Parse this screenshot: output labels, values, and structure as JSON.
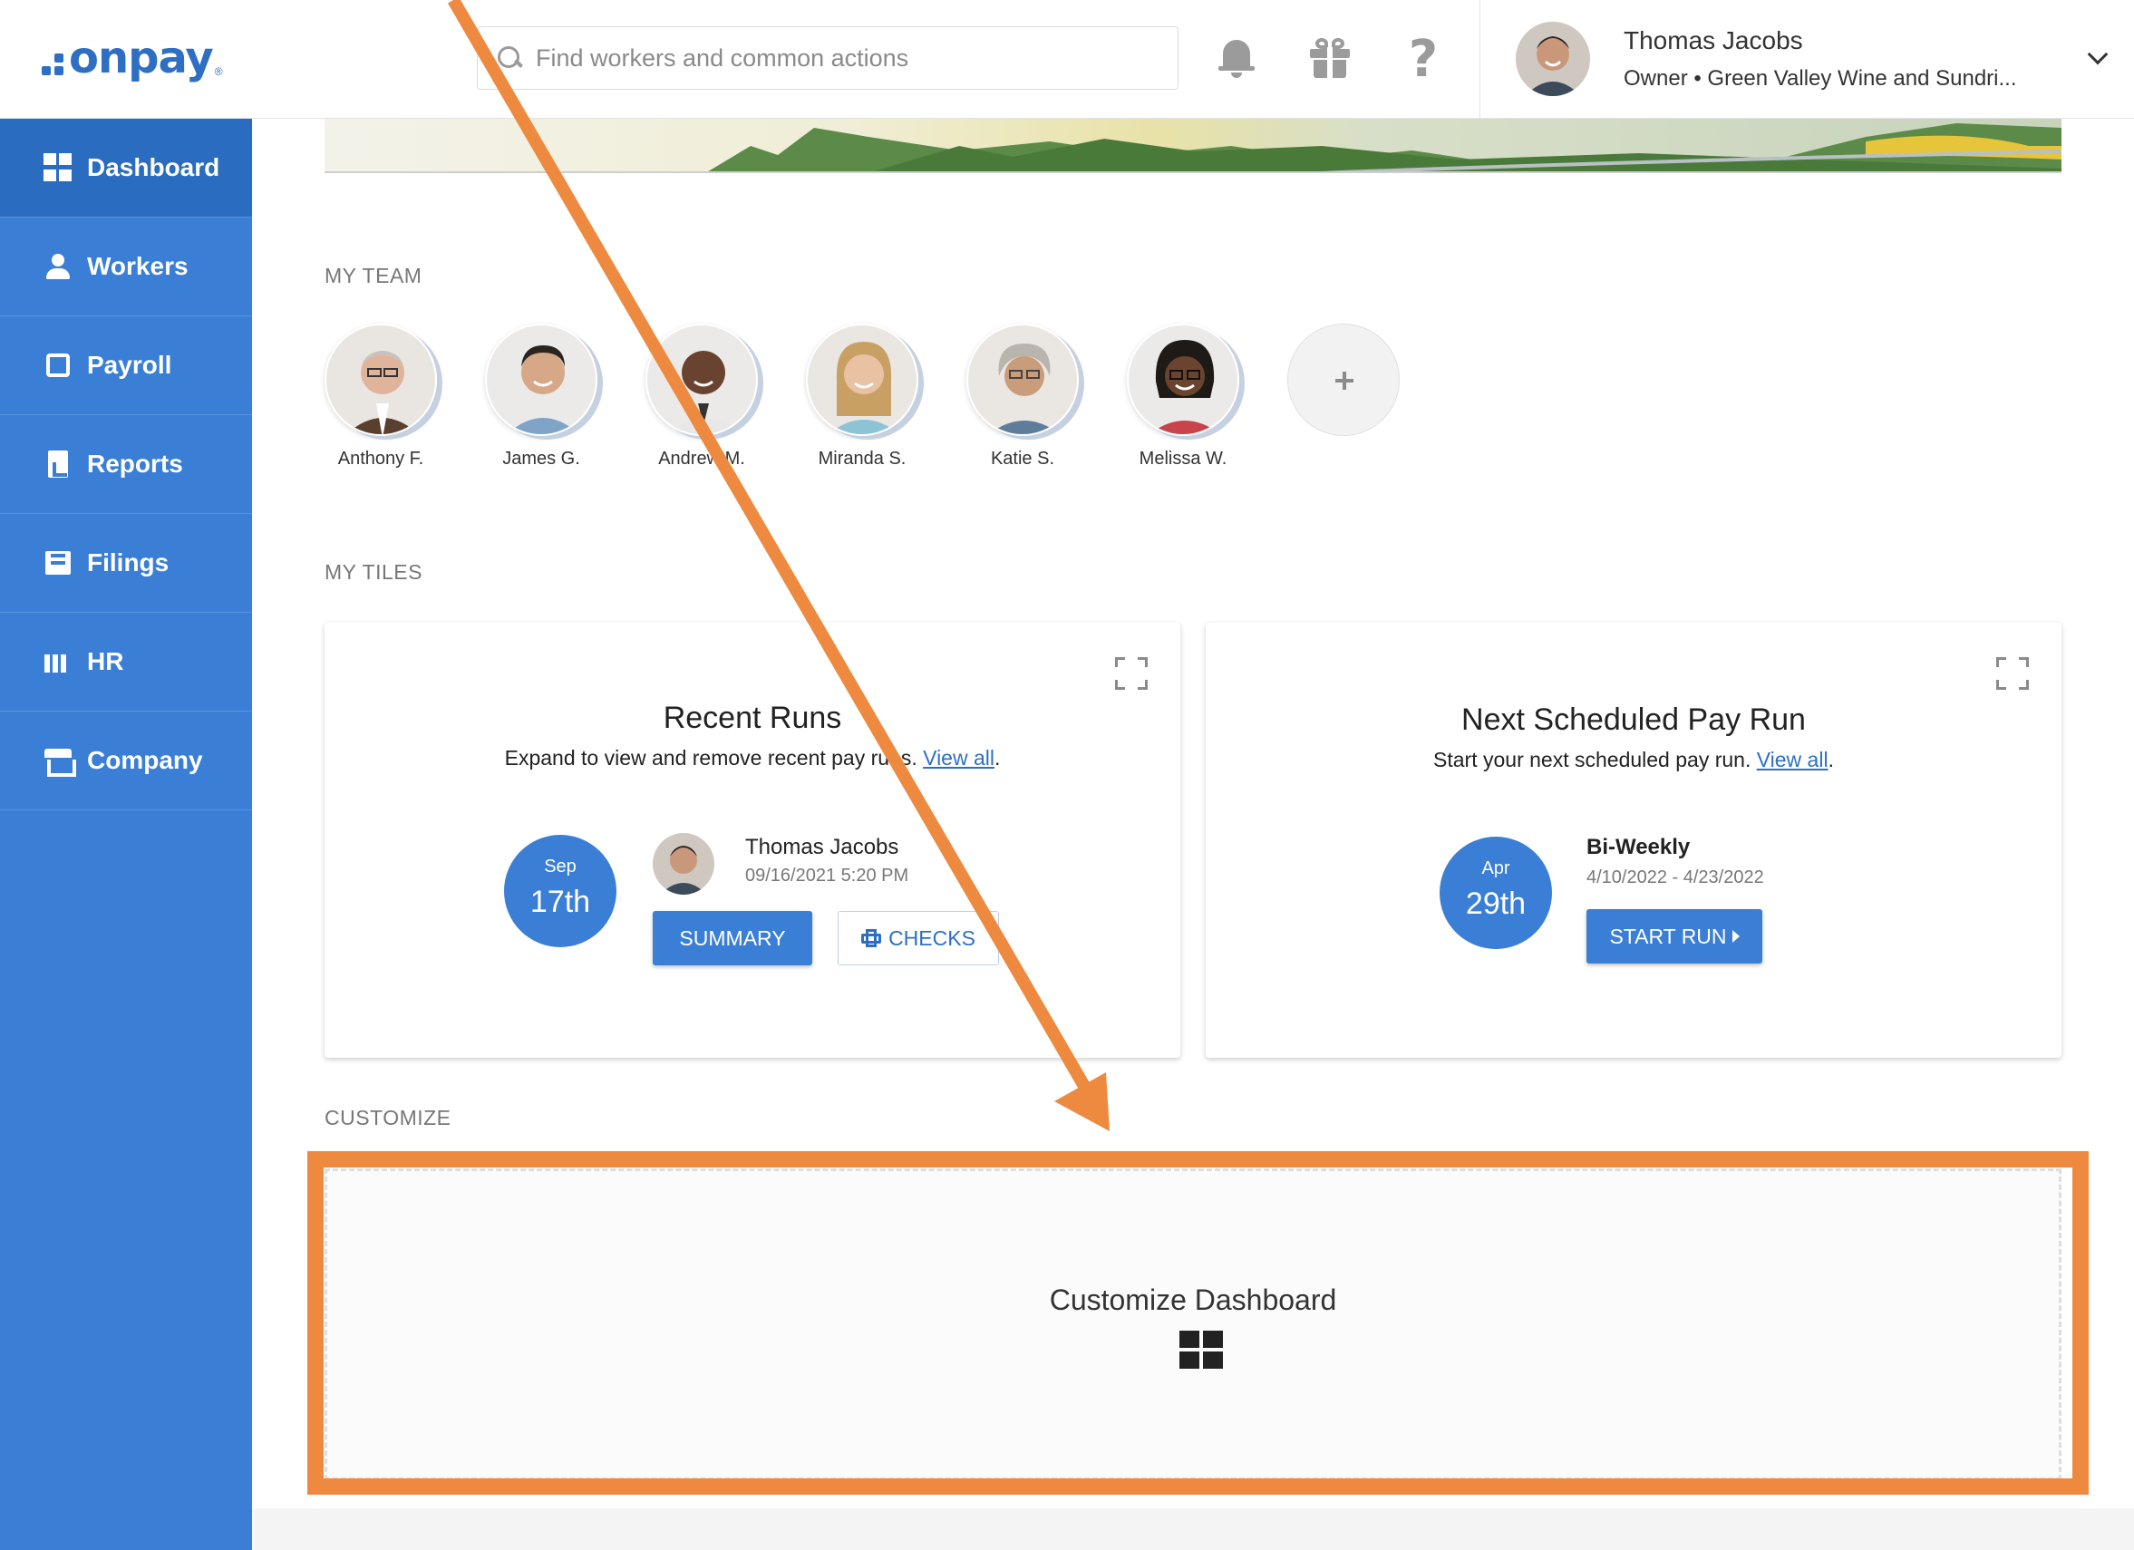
{
  "header": {
    "logo_text": "onpay",
    "logo_mark": "®",
    "search_placeholder": "Find workers and common actions",
    "icons": [
      "bell-icon",
      "gift-icon",
      "help-icon"
    ],
    "user": {
      "name": "Thomas Jacobs",
      "subtitle": "Owner • Green Valley Wine and Sundri..."
    }
  },
  "sidebar": {
    "items": [
      {
        "label": "Dashboard",
        "icon": "dashboard-icon",
        "active": true
      },
      {
        "label": "Workers",
        "icon": "workers-icon",
        "active": false
      },
      {
        "label": "Payroll",
        "icon": "payroll-icon",
        "active": false
      },
      {
        "label": "Reports",
        "icon": "reports-icon",
        "active": false
      },
      {
        "label": "Filings",
        "icon": "filings-icon",
        "active": false
      },
      {
        "label": "HR",
        "icon": "hr-icon",
        "active": false
      },
      {
        "label": "Company",
        "icon": "company-icon",
        "active": false
      }
    ]
  },
  "team": {
    "label": "MY TEAM",
    "members": [
      {
        "name": "Anthony F."
      },
      {
        "name": "James G."
      },
      {
        "name": "Andrew M."
      },
      {
        "name": "Miranda S."
      },
      {
        "name": "Katie S."
      },
      {
        "name": "Melissa W."
      }
    ]
  },
  "tiles": {
    "label": "MY TILES",
    "recent_runs": {
      "title": "Recent Runs",
      "subtitle": "Expand to view and remove recent pay runs.",
      "link": "View all",
      "period": ".",
      "month": "Sep",
      "day": "17th",
      "person": "Thomas Jacobs",
      "timestamp": "09/16/2021 5:20 PM",
      "summary_btn": "SUMMARY",
      "checks_btn": "CHECKS"
    },
    "next_run": {
      "title": "Next Scheduled Pay Run",
      "subtitle": "Start your next scheduled pay run.",
      "link": "View all",
      "period": ".",
      "month": "Apr",
      "day": "29th",
      "frequency": "Bi-Weekly",
      "range": "4/10/2022 - 4/23/2022",
      "start_btn": "START RUN"
    }
  },
  "customize": {
    "label": "CUSTOMIZE",
    "title": "Customize Dashboard"
  },
  "colors": {
    "brand_blue": "#3a7fd5",
    "annotation_orange": "#ee8a3f"
  }
}
